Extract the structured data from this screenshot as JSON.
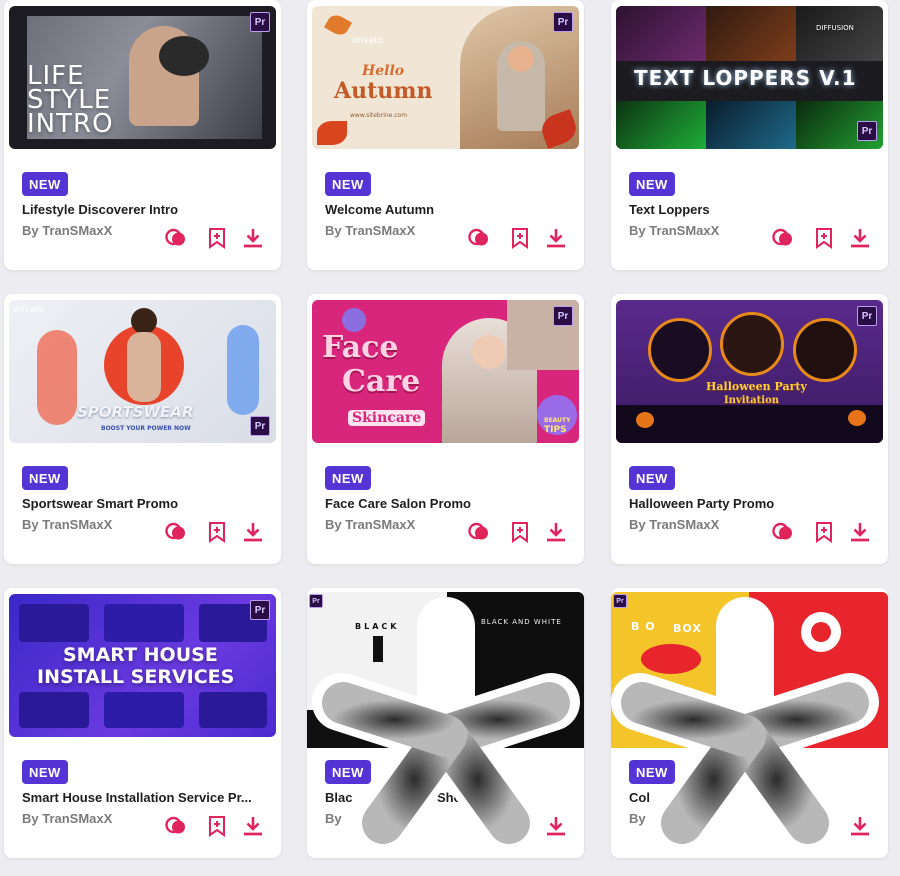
{
  "badge_label": "NEW",
  "pr_label": "Pr",
  "envato_label": "envato",
  "cards": [
    {
      "title": "Lifestyle Discoverer Intro",
      "author": "By TranSMaxX",
      "thumb_text": [
        "LIFE",
        "STYLE",
        "INTRO"
      ]
    },
    {
      "title": "Welcome Autumn",
      "author": "By TranSMaxX",
      "thumb_text": [
        "Hello",
        "Autumn",
        "www.sitebrine.com"
      ]
    },
    {
      "title": "Text Loppers",
      "author": "By TranSMaxX",
      "thumb_text": [
        "TEXT LOPPERS V.1",
        "DIFFUSION"
      ]
    },
    {
      "title": "Sportswear Smart Promo",
      "author": "By TranSMaxX",
      "thumb_text": [
        "SPORTSWEAR",
        "BOOST YOUR POWER NOW"
      ]
    },
    {
      "title": "Face Care Salon Promo",
      "author": "By TranSMaxX",
      "thumb_text": [
        "Face",
        "Care",
        "Skincare",
        "BEAUTY",
        "TIPS"
      ]
    },
    {
      "title": "Halloween Party Promo",
      "author": "By TranSMaxX",
      "thumb_text": [
        "Halloween Party",
        "Invitation"
      ]
    },
    {
      "title": "Smart House Installation Service Pr...",
      "author": "By TranSMaxX",
      "thumb_text": [
        "SMART HOUSE",
        "INSTALL SERVICES"
      ]
    },
    {
      "title": "Blac",
      "title_tail": "Sho",
      "author": "By",
      "thumb_text": [
        "BLACK",
        "BLACK AND WHITE"
      ]
    },
    {
      "title": "Col",
      "author": "By",
      "thumb_text": [
        "BOX"
      ]
    }
  ],
  "colors": {
    "accent": "#e0245e",
    "badge_bg": "#5534d6",
    "page_bg": "#ececf1"
  },
  "icons": [
    "blend-icon",
    "bookmark-add-icon",
    "download-icon"
  ]
}
